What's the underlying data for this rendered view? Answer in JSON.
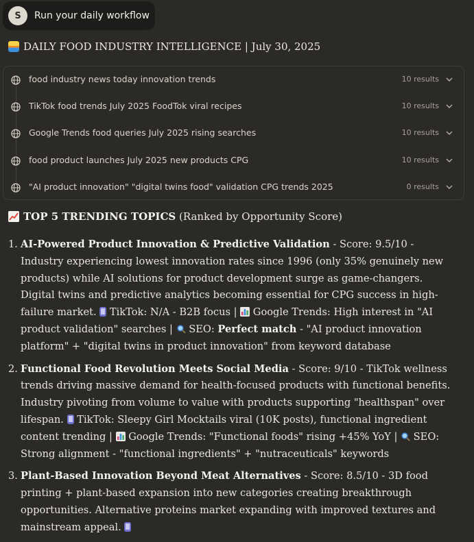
{
  "user_message": {
    "avatar_letter": "S",
    "text": "Run your daily workflow"
  },
  "heading": "DAILY FOOD INDUSTRY INTELLIGENCE | July 30, 2025",
  "searches": [
    {
      "query": "food industry news today innovation trends",
      "results": "10 results"
    },
    {
      "query": "TikTok food trends July 2025 FoodTok viral recipes",
      "results": "10 results"
    },
    {
      "query": "Google Trends food queries July 2025 rising searches",
      "results": "10 results"
    },
    {
      "query": "food product launches July 2025 new products CPG",
      "results": "10 results"
    },
    {
      "query": "\"AI product innovation\" \"digital twins food\" validation CPG trends 2025",
      "results": "0 results"
    }
  ],
  "topics_heading": {
    "bold": "TOP 5 TRENDING TOPICS",
    "rest": " (Ranked by Opportunity Score)"
  },
  "items": [
    {
      "num": "1.",
      "title": "AI-Powered Product Innovation & Predictive Validation",
      "text_a": " - Score: 9.5/10 - Industry experiencing lowest innovation rates since 1996 (only 35% genuinely new products) while AI solutions for product development surge as game-changers. Digital twins and predictive analytics becoming essential for CPG success in high-failure market. ",
      "text_b": " TikTok: N/A - B2B focus | ",
      "text_c": " Google Trends: High interest in \"AI product validation\" searches | ",
      "text_d": " SEO: ",
      "bold_b": "Perfect match",
      "text_e": " - \"AI product innovation platform\" + \"digital twins in product innovation\" from keyword database"
    },
    {
      "num": "2.",
      "title": "Functional Food Revolution Meets Social Media",
      "text_a": " - Score: 9/10 - TikTok wellness trends driving massive demand for health-focused products with functional benefits. Industry pivoting from volume to value with products supporting \"healthspan\" over lifespan. ",
      "text_b": " TikTok: Sleepy Girl Mocktails viral (10K posts), functional ingredient content trending | ",
      "text_c": " Google Trends: \"Functional foods\" rising +45% YoY | ",
      "text_d": " SEO: Strong alignment - \"functional ingredients\" + \"nutraceuticals\" keywords"
    },
    {
      "num": "3.",
      "title": "Plant-Based Innovation Beyond Meat Alternatives",
      "text_a": " - Score: 8.5/10 - 3D food printing + plant-based expansion into new categories creating breakthrough opportunities. Alternative proteins market expanding with improved textures and mainstream appeal. "
    }
  ]
}
